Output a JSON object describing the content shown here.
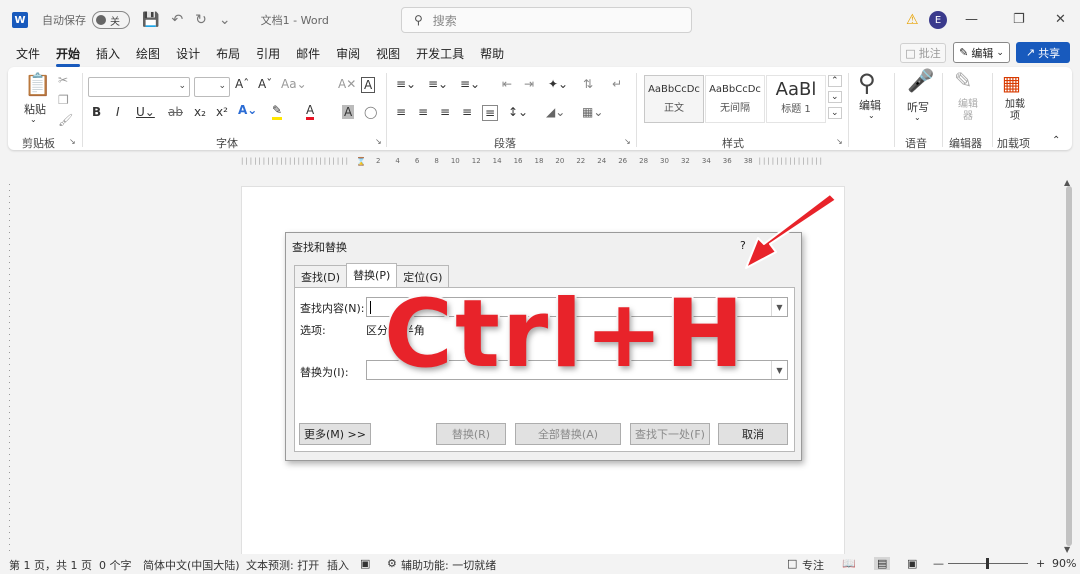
{
  "titlebar": {
    "app_badge": "W",
    "autosave_label": "自动保存",
    "autosave_state": "关",
    "doc_title": "文档1 - Word",
    "search_placeholder": "搜索",
    "avatar_initial": "E"
  },
  "menu": [
    "文件",
    "开始",
    "插入",
    "绘图",
    "设计",
    "布局",
    "引用",
    "邮件",
    "审阅",
    "视图",
    "开发工具",
    "帮助"
  ],
  "menu_active": "开始",
  "top_buttons": {
    "comment": "批注",
    "edit": "编辑",
    "share": "共享"
  },
  "ribbon": {
    "clipboard": {
      "paste": "粘贴",
      "label": "剪贴板"
    },
    "font_label": "字体",
    "paragraph_label": "段落",
    "styles_label": "样式",
    "styles": [
      {
        "sample": "AaBbCcDc",
        "name": "正文"
      },
      {
        "sample": "AaBbCcDc",
        "name": "无间隔"
      },
      {
        "sample": "AaBl",
        "name": "标题 1"
      }
    ],
    "edit": {
      "button": "编辑"
    },
    "voice": {
      "button": "听写",
      "label": "语音"
    },
    "editor": {
      "button": "编辑器",
      "label": "编辑器"
    },
    "addins": {
      "button": "加载项",
      "label": "加载项"
    }
  },
  "ruler_marks": [
    "2",
    "4",
    "6",
    "8",
    "10",
    "12",
    "14",
    "16",
    "18",
    "20",
    "22",
    "24",
    "26",
    "28",
    "30",
    "32",
    "34",
    "36",
    "38"
  ],
  "dialog": {
    "title": "查找和替换",
    "help": "?",
    "tabs": [
      "查找(D)",
      "替换(P)",
      "定位(G)"
    ],
    "active_tab": 1,
    "find_label": "查找内容(N):",
    "find_value": "",
    "options_label": "选项:",
    "options_value": "区分全/半角",
    "replace_label": "替换为(I):",
    "replace_value": "",
    "buttons": {
      "more": "更多(M) >>",
      "replace": "替换(R)",
      "replace_all": "全部替换(A)",
      "find_next": "查找下一处(F)",
      "cancel": "取消"
    }
  },
  "overlay_text": "Ctrl+H",
  "status": {
    "page": "第 1 页，共 1 页",
    "words": "0 个字",
    "language": "简体中文(中国大陆)",
    "prediction": "文本预测: 打开",
    "insert": "插入",
    "accessibility": "辅助功能: 一切就绪",
    "focus": "专注",
    "zoom": "90%"
  },
  "colors": {
    "accent": "#185abd",
    "overlay_red": "#e8232a"
  }
}
